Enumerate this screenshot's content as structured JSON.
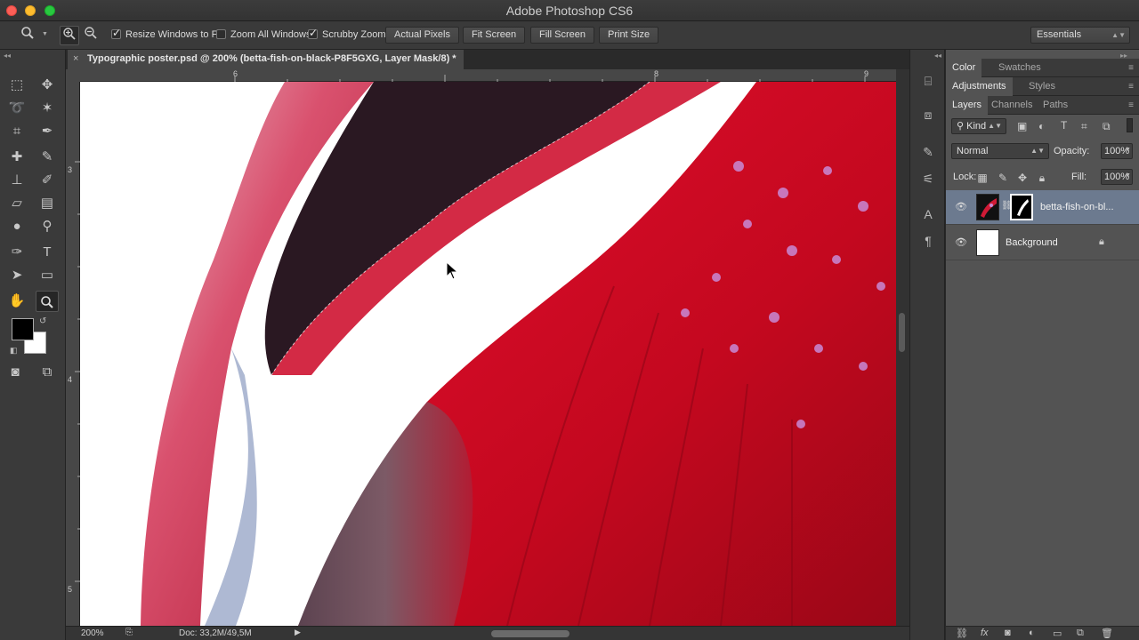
{
  "window": {
    "title": "Adobe Photoshop CS6"
  },
  "options_bar": {
    "resize_windows_label": "Resize Windows to Fit",
    "resize_windows_checked": true,
    "zoom_all_windows_label": "Zoom All Windows",
    "zoom_all_windows_checked": false,
    "scrubby_zoom_label": "Scrubby Zoom",
    "scrubby_zoom_checked": true,
    "actual_pixels": "Actual Pixels",
    "fit_screen": "Fit Screen",
    "fill_screen": "Fill Screen",
    "print_size": "Print Size",
    "workspace": "Essentials"
  },
  "document": {
    "tab_title": "Typographic poster.psd @ 200% (betta-fish-on-black-P8F5GXG, Layer Mask/8) *",
    "close_glyph": "×"
  },
  "rulers": {
    "horizontal": [
      "6",
      "8",
      "9"
    ],
    "vertical": [
      "3",
      "4",
      "5"
    ]
  },
  "status_bar": {
    "zoom": "200%",
    "doc_info": "Doc: 33,2M/49,5M"
  },
  "panels": {
    "tabs_row1": [
      "Color",
      "Swatches"
    ],
    "tabs_row2": [
      "Adjustments",
      "Styles"
    ],
    "tabs_row3": [
      "Layers",
      "Channels",
      "Paths"
    ],
    "filter_kind": "Kind",
    "blend_mode": "Normal",
    "opacity_label": "Opacity:",
    "opacity_value": "100%",
    "lock_label": "Lock:",
    "fill_label": "Fill:",
    "fill_value": "100%",
    "layers": [
      {
        "name": "betta-fish-on-bl...",
        "selected": true
      },
      {
        "name": "Background",
        "selected": false
      }
    ]
  },
  "colors": {
    "foreground": "#000000",
    "background": "#ffffff",
    "selected_layer": "#6c7a8f"
  }
}
